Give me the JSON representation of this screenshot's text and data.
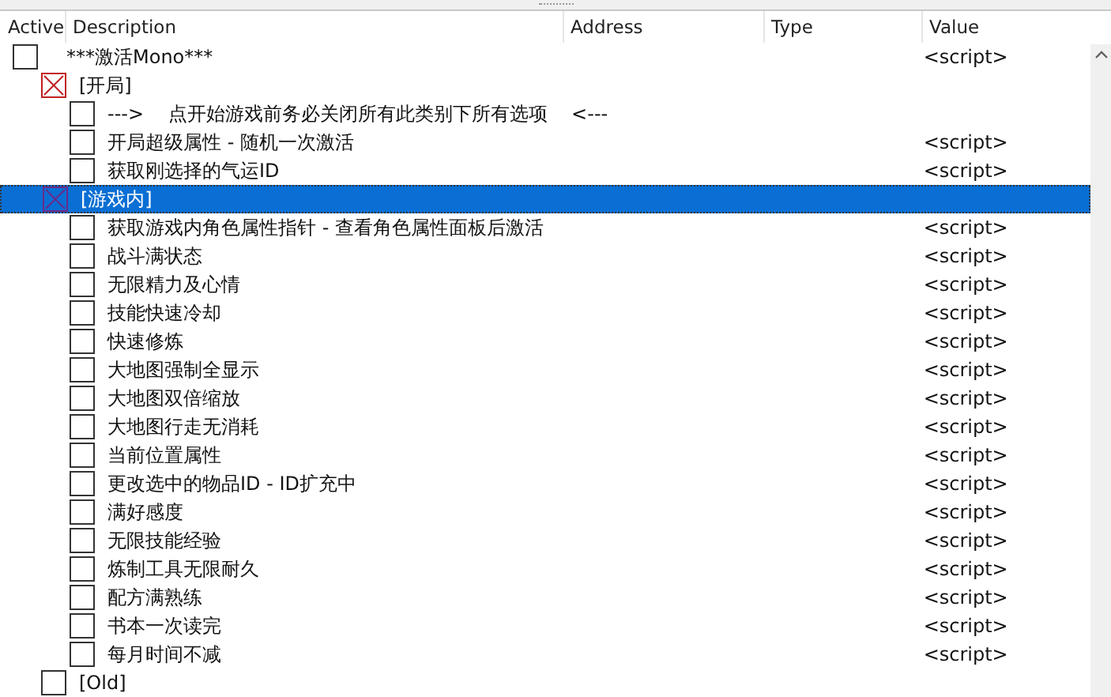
{
  "columns": [
    "Active",
    "Description",
    "Address",
    "Type",
    "Value"
  ],
  "entries": [
    {
      "description": "***激活Mono***",
      "value": "<script>",
      "checked": false,
      "selected": false,
      "children": [
        {
          "description": "[开局]",
          "checked": true,
          "selected": false,
          "children": [
            {
              "description": "--->    点开始游戏前务必关闭所有此类别下所有选项    <---",
              "checked": false,
              "selected": false
            },
            {
              "description": "开局超级属性 - 随机一次激活",
              "value": "<script>",
              "checked": false,
              "selected": false
            },
            {
              "description": "获取刚选择的气运ID",
              "value": "<script>",
              "checked": false,
              "selected": false
            }
          ]
        },
        {
          "description": "[游戏内]",
          "checked": true,
          "selected": true,
          "children": [
            {
              "description": "获取游戏内角色属性指针 - 查看角色属性面板后激活",
              "value": "<script>",
              "checked": false,
              "selected": false
            },
            {
              "description": "战斗满状态",
              "value": "<script>",
              "checked": false,
              "selected": false
            },
            {
              "description": "无限精力及心情",
              "value": "<script>",
              "checked": false,
              "selected": false
            },
            {
              "description": "技能快速冷却",
              "value": "<script>",
              "checked": false,
              "selected": false
            },
            {
              "description": "快速修炼",
              "value": "<script>",
              "checked": false,
              "selected": false
            },
            {
              "description": "大地图强制全显示",
              "value": "<script>",
              "checked": false,
              "selected": false
            },
            {
              "description": "大地图双倍缩放",
              "value": "<script>",
              "checked": false,
              "selected": false
            },
            {
              "description": "大地图行走无消耗",
              "value": "<script>",
              "checked": false,
              "selected": false
            },
            {
              "description": "当前位置属性",
              "value": "<script>",
              "checked": false,
              "selected": false
            },
            {
              "description": "更改选中的物品ID - ID扩充中",
              "value": "<script>",
              "checked": false,
              "selected": false
            },
            {
              "description": "满好感度",
              "value": "<script>",
              "checked": false,
              "selected": false
            },
            {
              "description": "无限技能经验",
              "value": "<script>",
              "checked": false,
              "selected": false
            },
            {
              "description": "炼制工具无限耐久",
              "value": "<script>",
              "checked": false,
              "selected": false
            },
            {
              "description": "配方满熟练",
              "value": "<script>",
              "checked": false,
              "selected": false
            },
            {
              "description": "书本一次读完",
              "value": "<script>",
              "checked": false,
              "selected": false
            },
            {
              "description": "每月时间不减",
              "value": "<script>",
              "checked": false,
              "selected": false
            }
          ]
        },
        {
          "description": "[Old]",
          "checked": false,
          "selected": false
        }
      ]
    }
  ]
}
